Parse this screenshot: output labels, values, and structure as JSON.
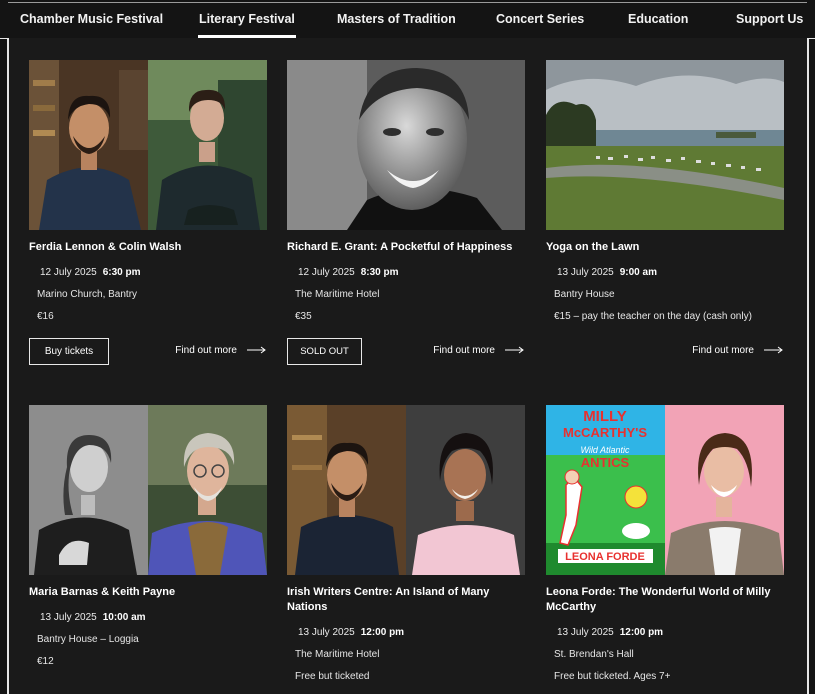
{
  "nav": {
    "items": [
      {
        "label": "Chamber Music Festival",
        "active": false
      },
      {
        "label": "Literary Festival",
        "active": true
      },
      {
        "label": "Masters of Tradition",
        "active": false
      },
      {
        "label": "Concert Series",
        "active": false
      },
      {
        "label": "Education",
        "active": false
      },
      {
        "label": "Support Us",
        "active": false
      }
    ]
  },
  "events": [
    {
      "title": "Ferdia Lennon & Colin Walsh",
      "date": "12 July 2025",
      "time": "6:30 pm",
      "venue": "Marino Church, Bantry",
      "price": "€16",
      "button": "Buy tickets",
      "more": "Find out more"
    },
    {
      "title": "Richard E. Grant: A Pocketful of Happiness",
      "date": "12 July 2025",
      "time": "8:30 pm",
      "venue": "The Maritime Hotel",
      "price": "€35",
      "button": "SOLD OUT",
      "more": "Find out more"
    },
    {
      "title": "Yoga on the Lawn",
      "date": "13 July 2025",
      "time": "9:00 am",
      "venue": "Bantry House",
      "price": "€15 – pay the teacher on the day (cash only)",
      "more": "Find out more"
    },
    {
      "title": "Maria Barnas & Keith Payne",
      "date": "13 July 2025",
      "time": "10:00 am",
      "venue": "Bantry House – Loggia",
      "price": "€12"
    },
    {
      "title": "Irish Writers Centre: An Island of Many Nations",
      "date": "13 July 2025",
      "time": "12:00 pm",
      "venue": "The Maritime Hotel",
      "price": "Free but ticketed"
    },
    {
      "title": "Leona Forde: The Wonderful World of Milly McCarthy",
      "date": "13 July 2025",
      "time": "12:00 pm",
      "venue": "St. Brendan's Hall",
      "price": "Free but ticketed. Ages 7+",
      "book_cover": {
        "lines": [
          "MILLY",
          "McCARTHY'S",
          "Wild Atlantic",
          "ANTICS",
          "LEONA FORDE"
        ]
      }
    }
  ]
}
